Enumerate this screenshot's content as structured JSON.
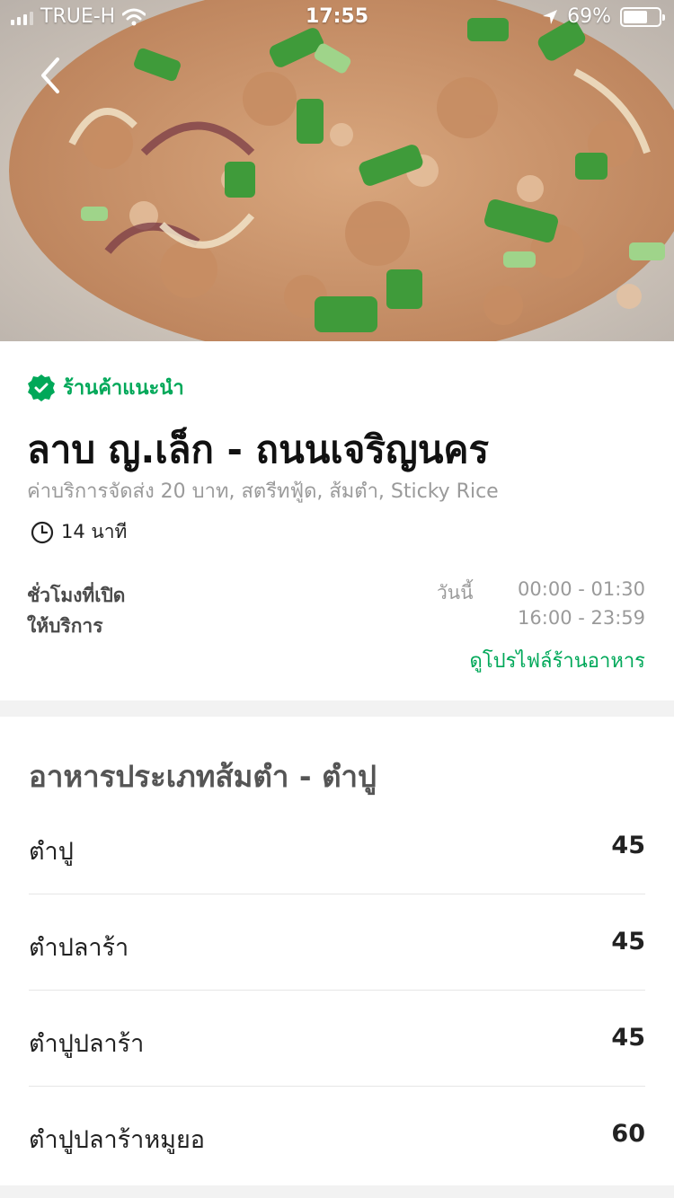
{
  "status_bar": {
    "carrier": "TRUE-H",
    "time": "17:55",
    "battery": "69%",
    "battery_level": 0.69
  },
  "restaurant": {
    "badge": "ร้านค้าแนะนำ",
    "name": "ลาบ ญ.เล็ก - ถนนเจริญนคร",
    "tags": "ค่าบริการจัดส่ง 20 บาท, สตรีทฟู้ด, ส้มตำ, Sticky Rice",
    "delivery_time": "14 นาที",
    "hours_label_line1": "ชั่วโมงที่เปิด",
    "hours_label_line2": "ให้บริการ",
    "hours_day": "วันนี้",
    "hours": [
      "00:00 - 01:30",
      "16:00 - 23:59"
    ],
    "profile_link": "ดูโปรไฟล์ร้านอาหาร"
  },
  "menu": {
    "section_title": "อาหารประเภทส้มตำ - ตำปู",
    "items": [
      {
        "name": "ตำปู",
        "price": "45"
      },
      {
        "name": "ตำปลาร้า",
        "price": "45"
      },
      {
        "name": "ตำปูปลาร้า",
        "price": "45"
      },
      {
        "name": "ตำปูปลาร้าหมูยอ",
        "price": "60"
      }
    ]
  },
  "colors": {
    "accent": "#00a859",
    "muted_text": "#9a9a9a",
    "background": "#f2f2f2"
  },
  "icons": {
    "back": "chevron-left-icon",
    "recommended": "verified-badge-icon",
    "delivery_time": "clock-icon",
    "wifi": "wifi-icon",
    "location": "location-arrow-icon",
    "battery": "battery-icon"
  }
}
